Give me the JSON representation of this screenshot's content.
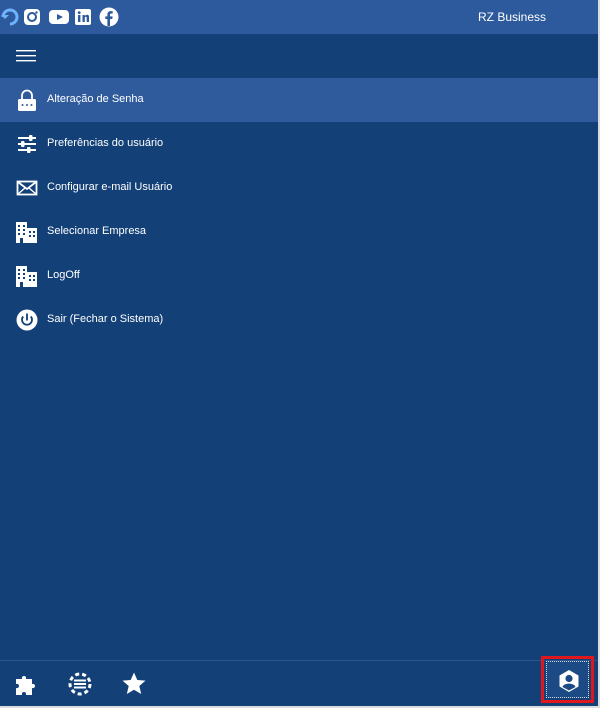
{
  "titlebar": {
    "title": "RZ Business",
    "social_icons": [
      "instagram-icon",
      "youtube-icon",
      "linkedin-icon",
      "facebook-icon"
    ]
  },
  "menu": {
    "items": [
      {
        "label": "Alteração de Senha",
        "icon": "lock-icon",
        "active": true
      },
      {
        "label": "Preferências do usuário",
        "icon": "sliders-icon",
        "active": false
      },
      {
        "label": "Configurar e-mail Usuário",
        "icon": "mail-icon",
        "active": false
      },
      {
        "label": "Selecionar Empresa",
        "icon": "building-icon",
        "active": false
      },
      {
        "label": "LogOff",
        "icon": "building-icon",
        "active": false
      },
      {
        "label": "Sair (Fechar o Sistema)",
        "icon": "power-icon",
        "active": false
      }
    ]
  },
  "bottombar": {
    "icons": [
      "puzzle-icon",
      "settings-list-icon",
      "star-icon",
      "user-icon"
    ]
  },
  "colors": {
    "background": "#124077",
    "titlebar": "#2c5a9c",
    "active_item": "#2f5b9d",
    "highlight_border": "#e0181e"
  }
}
